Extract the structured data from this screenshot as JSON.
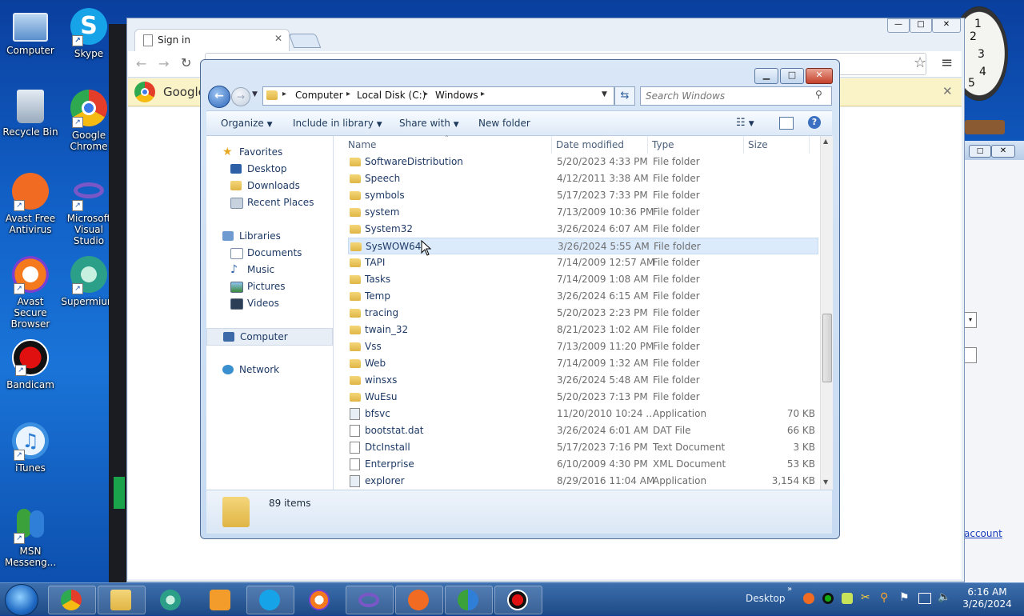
{
  "desktop_icons": [
    {
      "label": "Computer"
    },
    {
      "label": "Skype"
    },
    {
      "label": "Recycle Bin"
    },
    {
      "label": "Google Chrome"
    },
    {
      "label": "Avast Free Antivirus"
    },
    {
      "label": "Microsoft Visual Studio"
    },
    {
      "label": "Avast Secure Browser"
    },
    {
      "label": "Supermium"
    },
    {
      "label": "Bandicam"
    },
    {
      "label": "iTunes"
    },
    {
      "label": "MSN Messeng..."
    }
  ],
  "chrome": {
    "tab_title": "Sign in",
    "infobar_text": "Google"
  },
  "explorer": {
    "breadcrumb": [
      "Computer",
      "Local Disk (C:)",
      "Windows"
    ],
    "search_placeholder": "Search Windows",
    "toolbar": {
      "organize": "Organize",
      "include_in_library": "Include in library",
      "share_with": "Share with",
      "new_folder": "New folder"
    },
    "nav": {
      "favorites": "Favorites",
      "favorites_items": [
        "Desktop",
        "Downloads",
        "Recent Places"
      ],
      "libraries": "Libraries",
      "libraries_items": [
        "Documents",
        "Music",
        "Pictures",
        "Videos"
      ],
      "computer": "Computer",
      "network": "Network"
    },
    "columns": {
      "name": "Name",
      "date": "Date modified",
      "type": "Type",
      "size": "Size"
    },
    "files": [
      {
        "name": "SoftwareDistribution",
        "date": "5/20/2023 4:33 PM",
        "type": "File folder",
        "size": "",
        "kind": "folder"
      },
      {
        "name": "Speech",
        "date": "4/12/2011 3:38 AM",
        "type": "File folder",
        "size": "",
        "kind": "folder"
      },
      {
        "name": "symbols",
        "date": "5/17/2023 7:33 PM",
        "type": "File folder",
        "size": "",
        "kind": "folder"
      },
      {
        "name": "system",
        "date": "7/13/2009 10:36 PM",
        "type": "File folder",
        "size": "",
        "kind": "folder"
      },
      {
        "name": "System32",
        "date": "3/26/2024 6:07 AM",
        "type": "File folder",
        "size": "",
        "kind": "folder"
      },
      {
        "name": "SysWOW64",
        "date": "3/26/2024 5:55 AM",
        "type": "File folder",
        "size": "",
        "kind": "folder"
      },
      {
        "name": "TAPI",
        "date": "7/14/2009 12:57 AM",
        "type": "File folder",
        "size": "",
        "kind": "folder"
      },
      {
        "name": "Tasks",
        "date": "7/14/2009 1:08 AM",
        "type": "File folder",
        "size": "",
        "kind": "folder"
      },
      {
        "name": "Temp",
        "date": "3/26/2024 6:15 AM",
        "type": "File folder",
        "size": "",
        "kind": "folder"
      },
      {
        "name": "tracing",
        "date": "5/20/2023 2:23 PM",
        "type": "File folder",
        "size": "",
        "kind": "folder"
      },
      {
        "name": "twain_32",
        "date": "8/21/2023 1:02 AM",
        "type": "File folder",
        "size": "",
        "kind": "folder"
      },
      {
        "name": "Vss",
        "date": "7/13/2009 11:20 PM",
        "type": "File folder",
        "size": "",
        "kind": "folder"
      },
      {
        "name": "Web",
        "date": "7/14/2009 1:32 AM",
        "type": "File folder",
        "size": "",
        "kind": "folder"
      },
      {
        "name": "winsxs",
        "date": "3/26/2024 5:48 AM",
        "type": "File folder",
        "size": "",
        "kind": "folder"
      },
      {
        "name": "WuEsu",
        "date": "5/20/2023 7:13 PM",
        "type": "File folder",
        "size": "",
        "kind": "folder"
      },
      {
        "name": "bfsvc",
        "date": "11/20/2010 10:24 ...",
        "type": "Application",
        "size": "70 KB",
        "kind": "app"
      },
      {
        "name": "bootstat.dat",
        "date": "3/26/2024 6:01 AM",
        "type": "DAT File",
        "size": "66 KB",
        "kind": "file"
      },
      {
        "name": "DtcInstall",
        "date": "5/17/2023 7:16 PM",
        "type": "Text Document",
        "size": "3 KB",
        "kind": "file"
      },
      {
        "name": "Enterprise",
        "date": "6/10/2009 4:30 PM",
        "type": "XML Document",
        "size": "53 KB",
        "kind": "file"
      },
      {
        "name": "explorer",
        "date": "8/29/2016 11:04 AM",
        "type": "Application",
        "size": "3,154 KB",
        "kind": "app"
      }
    ],
    "selected_row_name": "SysWOW64",
    "status_count": "89 items"
  },
  "taskbar": {
    "desktop_label": "Desktop",
    "time": "6:16 AM",
    "date": "3/26/2024"
  },
  "right_window": {
    "link_text": "account"
  },
  "colors": {
    "accent": "#1e3a66",
    "selection": "#dcebfc",
    "desktop": "#1262c9"
  }
}
